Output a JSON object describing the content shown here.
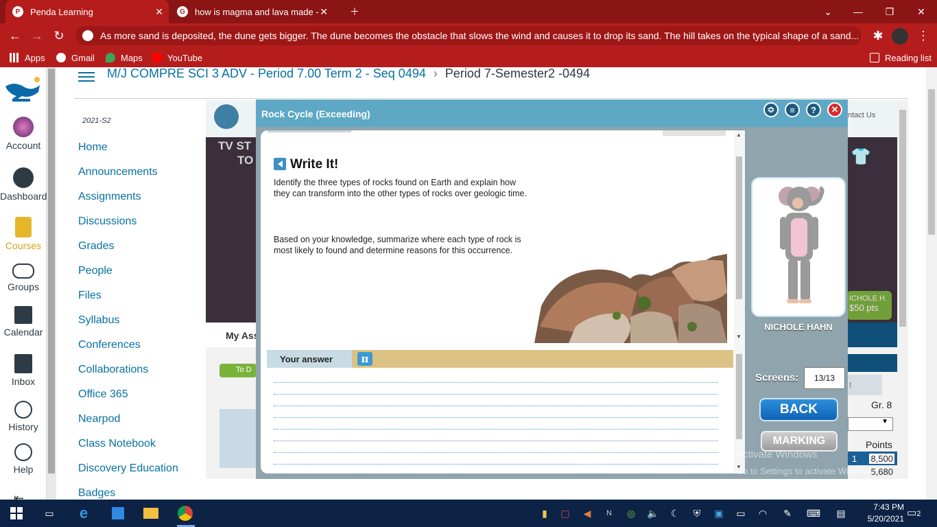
{
  "browser": {
    "tabs": [
      {
        "label": "Penda Learning"
      },
      {
        "label": "how is magma and lava made - G"
      }
    ],
    "url": "As more sand is deposited, the dune gets bigger. The dune becomes the obstacle that slows the wind and causes it to drop its sand. The hill takes on the typical shape of a sand...",
    "bookmarks": [
      "Apps",
      "Gmail",
      "Maps",
      "YouTube"
    ],
    "reading_list": "Reading list"
  },
  "global_nav": {
    "items": [
      {
        "label": "Account"
      },
      {
        "label": "Dashboard"
      },
      {
        "label": "Courses"
      },
      {
        "label": "Groups"
      },
      {
        "label": "Calendar"
      },
      {
        "label": "Inbox"
      },
      {
        "label": "History"
      },
      {
        "label": "Help"
      }
    ]
  },
  "header": {
    "course": "M/J COMPRE SCI 3 ADV - Period 7.00 Term 2 - Seq 0494",
    "separator": "›",
    "current": "Period 7-Semester2 -0494"
  },
  "course_nav": {
    "term": "2021-S2",
    "links": [
      "Home",
      "Announcements",
      "Assignments",
      "Discussions",
      "Grades",
      "People",
      "Files",
      "Syllabus",
      "Conferences",
      "Collaborations",
      "Office 365",
      "Nearpod",
      "Class Notebook",
      "Discovery Education",
      "Badges"
    ]
  },
  "penda_bg": {
    "contact": "ntact Us",
    "tv_text_1": "TV ST",
    "tv_text_2": "TO",
    "my_assignments": "My Ass",
    "todo": "To D",
    "grade": "Gr. 8",
    "points_header": "Points",
    "row1_rank": "1",
    "row1_points": "8,500",
    "row2_points": "5,680",
    "badge_name": "ICHOLE H.",
    "badge_points": "$50 pts",
    "tab_text": "t"
  },
  "modal": {
    "title": "Rock Cycle (Exceeding)",
    "section_title": "Write It!",
    "prompt_1": "Identify the three types of rocks found on Earth and explain how they can transform into the other types of rocks over geologic time.",
    "prompt_2": "Based on your knowledge, summarize where each type of rock is most likely to found and determine reasons for this occurrence.",
    "answer_label": "Your answer",
    "pi_symbol": "π",
    "student_name": "NICHOLE HAHN",
    "screens_label": "Screens:",
    "screens_value": "13/13",
    "back_label": "BACK",
    "marking_label": "MARKING"
  },
  "watermark": {
    "line1": "Activate Windows",
    "line2": "Go to Settings to activate Windows."
  },
  "taskbar": {
    "time": "7:43 PM",
    "date": "5/20/2021",
    "notifications": "2"
  }
}
